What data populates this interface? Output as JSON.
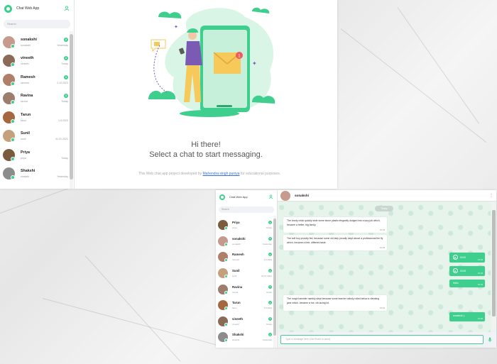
{
  "colors": {
    "accent": "#3ecf8e",
    "link": "#3b6fd8",
    "text": "#555555"
  },
  "app1": {
    "title": "Chat Web App",
    "search_placeholder": "Search",
    "chats": [
      {
        "name": "sonakshi",
        "sub": "sonakshi",
        "time": "Yesterday",
        "badge": "2",
        "avatar_color": "#c79a8e"
      },
      {
        "name": "vineeth",
        "sub": "vineeth",
        "time": "Today",
        "badge": "2",
        "avatar_color": "#8b6a58"
      },
      {
        "name": "Ramesh",
        "sub": "ramesh",
        "time": "1.10.2023",
        "badge": "1",
        "avatar_color": "#b07f6a"
      },
      {
        "name": "Ravina",
        "sub": "ravina",
        "time": "Today",
        "badge": "1",
        "avatar_color": "#9d7d6b"
      },
      {
        "name": "Tarun",
        "sub": "tarun",
        "time": "1.6.2023",
        "badge": "",
        "avatar_color": "#a5673f"
      },
      {
        "name": "Sunil",
        "sub": "sunil",
        "time": "31.01.2021",
        "badge": "",
        "avatar_color": "#c6a07c"
      },
      {
        "name": "Priya",
        "sub": "priya",
        "time": "Today",
        "badge": "",
        "avatar_color": "#7a5b3d"
      },
      {
        "name": "Shakshi",
        "sub": "shakshi",
        "time": "Yesterday",
        "badge": "",
        "avatar_color": "#8c8c8c"
      }
    ],
    "welcome": {
      "title": "Hi there!",
      "subtitle": "Select a chat to start messaging.",
      "credit_prefix": "This Web chat app project developed by ",
      "credit_link": "Mahendra singh puniya",
      "credit_suffix": " for educational purposes."
    }
  },
  "app2": {
    "title": "Chat Web App",
    "search_placeholder": "Search",
    "chats": [
      {
        "name": "Priya",
        "sub": "priya",
        "time": "Today",
        "badge": "1",
        "avatar_color": "#7a5b3d"
      },
      {
        "name": "sonakshi",
        "sub": "sonakshi",
        "time": "Yesterday",
        "badge": "1",
        "avatar_color": "#c79a8e"
      },
      {
        "name": "Ramesh",
        "sub": "ramesh",
        "time": "1.4.2023",
        "badge": "1",
        "avatar_color": "#b07f6a"
      },
      {
        "name": "Sunil",
        "sub": "sunil",
        "time": "16.07.2021",
        "badge": "1",
        "avatar_color": "#c6a07c"
      },
      {
        "name": "Ravina",
        "sub": "ravina",
        "time": "Today",
        "badge": "1",
        "avatar_color": "#9d7d6b"
      },
      {
        "name": "Tarun",
        "sub": "tarun",
        "time": "1.6.2023",
        "badge": "1",
        "avatar_color": "#a5673f"
      },
      {
        "name": "vineeth",
        "sub": "vineeth",
        "time": "Today",
        "badge": "1",
        "avatar_color": "#8b6a58"
      },
      {
        "name": "Shakshi",
        "sub": "shakshi",
        "time": "Yesterday",
        "badge": "1",
        "avatar_color": "#8c8c8c"
      }
    ],
    "conversation": {
      "contact": "sonakshi",
      "day_label": "Today",
      "messages": [
        {
          "dir": "in",
          "type": "text",
          "text": "The lovely chick quickly stole some stone plastic elegantly dodged into a lazy job which, became a better, big family.",
          "time": "10:18"
        },
        {
          "dir": "in",
          "type": "text",
          "text": "The soft boy proudly fed, because some old lady proudly slept above a professional fire fly which, became a free, different taste.",
          "time": "10:18"
        },
        {
          "dir": "out",
          "type": "audio",
          "duration": "00:05",
          "time": "10:18"
        },
        {
          "dir": "out",
          "type": "audio",
          "duration": "00:08",
          "time": "10:18"
        },
        {
          "dir": "out",
          "type": "text",
          "text": "Hello",
          "time": "10:19"
        },
        {
          "dir": "in",
          "type": "text",
          "text": "The rough hamster hambly slept because some teacher calmly rolled below a vibrating jane which, became a hot, vib lazing lot.",
          "time": "10:22"
        },
        {
          "dir": "out",
          "type": "text",
          "text": "sonakshi :)",
          "time": "10:25"
        }
      ],
      "composer_placeholder": "Type a message here (Ctrl+Enter to send)"
    }
  }
}
